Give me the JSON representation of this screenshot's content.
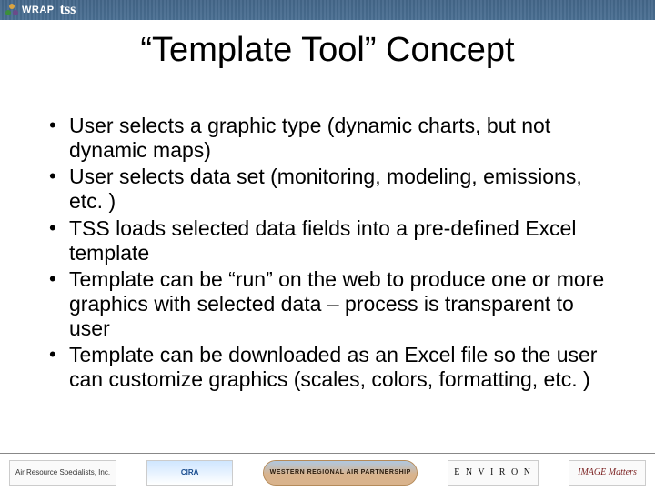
{
  "header": {
    "wrap_label": "WRAP",
    "tss_label": "tss"
  },
  "title": "“Template Tool” Concept",
  "bullets": [
    "User selects a graphic type (dynamic charts, but not dynamic maps)",
    "User selects data set (monitoring, modeling, emissions, etc. )",
    "TSS loads selected data fields into a pre-defined Excel template",
    "Template can be “run” on the web to produce one or more graphics with selected data – process is transparent to user",
    "Template can be downloaded as an Excel file so the user can customize graphics (scales, colors, formatting, etc. )"
  ],
  "footer": {
    "air": "Air Resource Specialists, Inc.",
    "cira": "CIRA",
    "wrap": "WESTERN REGIONAL AIR PARTNERSHIP",
    "environ": "E N V I R O N",
    "image": "IMAGE Matters"
  }
}
